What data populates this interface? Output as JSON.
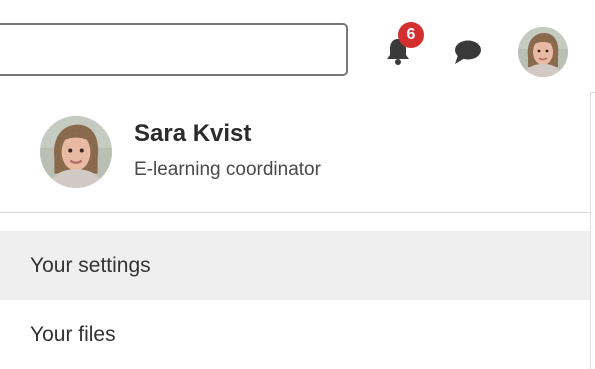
{
  "header": {
    "search_value": "",
    "notifications_icon": "bell-icon",
    "notification_count": "6",
    "messages_icon": "chat-bubble-icon",
    "badge_color": "#d42f2f",
    "icon_color": "#3a3a3a"
  },
  "profile": {
    "name": "Sara Kvist",
    "role": "E-learning coordinator"
  },
  "menu": {
    "items": [
      {
        "label": "Your settings",
        "highlighted": true
      },
      {
        "label": "Your files",
        "highlighted": false
      }
    ]
  }
}
